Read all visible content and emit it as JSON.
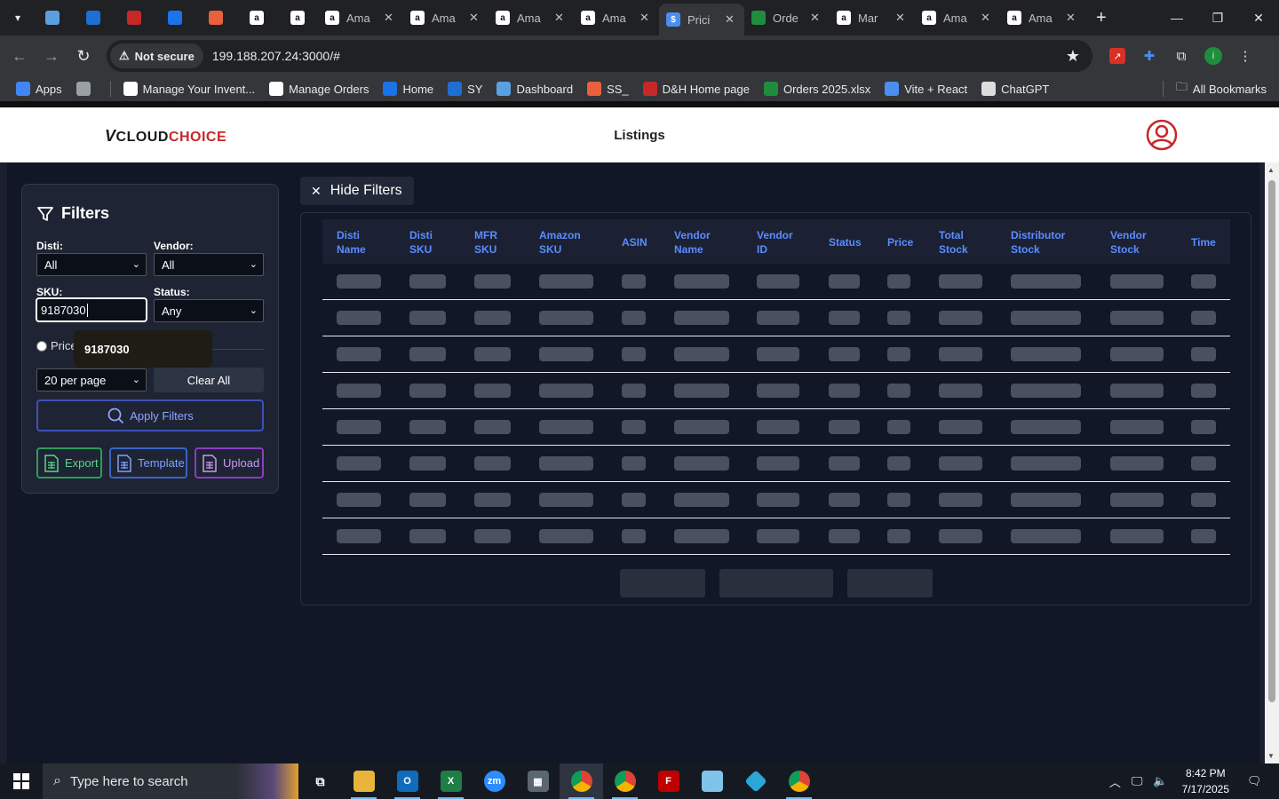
{
  "browser": {
    "tabs": [
      {
        "icon": "app-icon",
        "title": "",
        "color": "#5aa0e0"
      },
      {
        "icon": "ec-icon",
        "title": "",
        "color": "#1f6fd1"
      },
      {
        "icon": "dh-icon",
        "title": "",
        "color": "#c62828"
      },
      {
        "icon": "google-icon",
        "title": "",
        "color": "#1a73e8"
      },
      {
        "icon": "stack-icon",
        "title": "",
        "color": "#e8613c"
      },
      {
        "icon": "amazon-icon",
        "title": "",
        "color": "#ffffff"
      },
      {
        "icon": "amazon-icon",
        "title": "",
        "color": "#ffffff"
      },
      {
        "icon": "amazon-icon",
        "title": "Ama",
        "color": "#ffffff"
      },
      {
        "icon": "amazon-icon",
        "title": "Ama",
        "color": "#ffffff"
      },
      {
        "icon": "amazon-icon",
        "title": "Ama",
        "color": "#ffffff"
      },
      {
        "icon": "amazon-icon",
        "title": "Ama",
        "color": "#ffffff"
      },
      {
        "icon": "dollar-icon",
        "title": "Prici",
        "color": "#4a8ef0",
        "active": true
      },
      {
        "icon": "excel-icon",
        "title": "Orde",
        "color": "#1e8e3e"
      },
      {
        "icon": "amazon-icon",
        "title": "Mar",
        "color": "#ffffff"
      },
      {
        "icon": "amazon-icon",
        "title": "Ama",
        "color": "#ffffff"
      },
      {
        "icon": "amazon-icon",
        "title": "Ama",
        "color": "#ffffff"
      }
    ],
    "not_secure": "Not secure",
    "url": "199.188.207.24:3000/#",
    "bookmarks": [
      {
        "label": "Apps",
        "color": "#4285f4"
      },
      {
        "label": "",
        "color": "#9aa0a6"
      },
      {
        "label": "Manage Your Invent...",
        "color": "#ffffff"
      },
      {
        "label": "Manage Orders",
        "color": "#ffffff"
      },
      {
        "label": "Home",
        "color": "#1a73e8"
      },
      {
        "label": "SY",
        "color": "#1f6fd1"
      },
      {
        "label": "Dashboard",
        "color": "#5aa0e0"
      },
      {
        "label": "SS_",
        "color": "#e8613c"
      },
      {
        "label": "D&H Home page",
        "color": "#c62828"
      },
      {
        "label": "Orders 2025.xlsx",
        "color": "#1e8e3e"
      },
      {
        "label": "Vite + React",
        "color": "#4a8ef0"
      },
      {
        "label": "ChatGPT",
        "color": "#dddddd"
      }
    ],
    "all_bookmarks": "All Bookmarks"
  },
  "header": {
    "logo_prefix": "V",
    "logo_cloud": "CLOUD",
    "logo_choice": "CHOICE",
    "title": "Listings"
  },
  "filters": {
    "title": "Filters",
    "disti_label": "Disti:",
    "disti_value": "All",
    "vendor_label": "Vendor:",
    "vendor_value": "All",
    "sku_label": "SKU:",
    "sku_value": "9187030",
    "status_label": "Status:",
    "status_value": "Any",
    "price_label": "Price",
    "autocomplete_option": "9187030",
    "per_page_value": "20 per page",
    "clear_label": "Clear All",
    "apply_label": "Apply Filters",
    "export_label": "Export",
    "template_label": "Template",
    "upload_label": "Upload"
  },
  "table": {
    "hide_filters_label": "Hide Filters",
    "columns": [
      [
        "Disti",
        "Name"
      ],
      [
        "Disti",
        "SKU"
      ],
      [
        "MFR",
        "SKU"
      ],
      [
        "Amazon",
        "SKU"
      ],
      [
        "ASIN"
      ],
      [
        "Vendor",
        "Name"
      ],
      [
        "Vendor",
        "ID"
      ],
      [
        "Status"
      ],
      [
        "Price"
      ],
      [
        "Total",
        "Stock"
      ],
      [
        "Distributor",
        "Stock"
      ],
      [
        "Vendor",
        "Stock"
      ],
      [
        "Time"
      ]
    ],
    "loading_rows": 8
  },
  "taskbar": {
    "search_placeholder": "Type here to search",
    "time": "8:42 PM",
    "date": "7/17/2025"
  },
  "colors": {
    "accent_blue": "#5b8cff",
    "export_green": "#2e9c5a",
    "template_blue": "#3b63c7",
    "upload_purple": "#8a3dc4"
  }
}
